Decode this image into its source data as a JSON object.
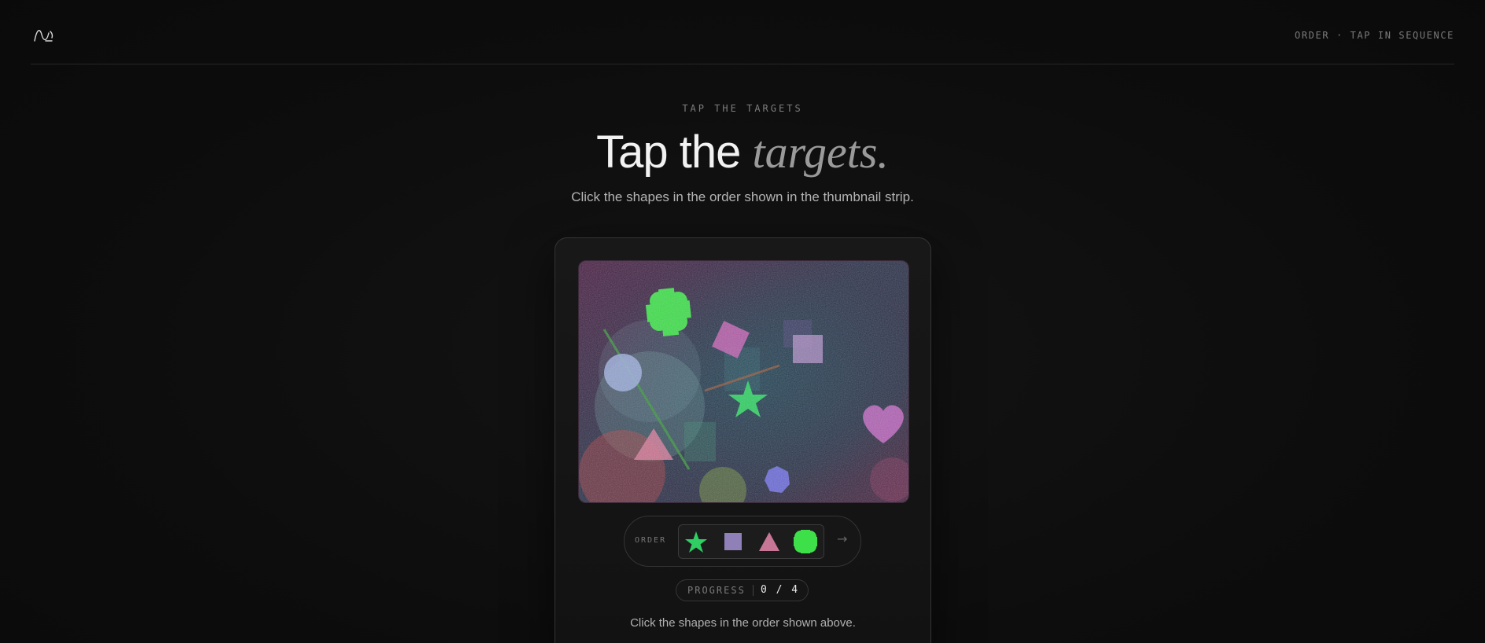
{
  "header": {
    "logo_icon": "wave-logo-icon",
    "mode_label": "ORDER · TAP IN SEQUENCE"
  },
  "hero": {
    "eyebrow": "TAP THE TARGETS",
    "title_plain": "Tap the ",
    "title_italic": "targets.",
    "subtitle": "Click the shapes in the order shown in the thumbnail strip."
  },
  "challenge": {
    "canvas_shapes": [
      "cross-icon",
      "diamond-icon",
      "square-icon",
      "circle-icon",
      "star-icon",
      "heart-icon",
      "triangle-icon",
      "hexagon-icon"
    ],
    "order_label": "ORDER",
    "order_sequence": [
      "star-icon",
      "square-icon",
      "triangle-icon",
      "cross-icon"
    ],
    "next_icon": "arrow-right-icon",
    "next_glyph": "→",
    "progress_label": "PROGRESS",
    "progress_value": "0 / 4",
    "progress_done": 0,
    "progress_total": 4,
    "instruction": "Click the shapes in the order shown above."
  },
  "colors": {
    "accent_green": "#3ee04a",
    "star_green": "#2fcf63",
    "pink": "#c86aa8",
    "lavender": "#a08fc0",
    "blue_circle": "#8a9bd0",
    "violet": "#7070e0",
    "background": "#0b0b0b"
  }
}
